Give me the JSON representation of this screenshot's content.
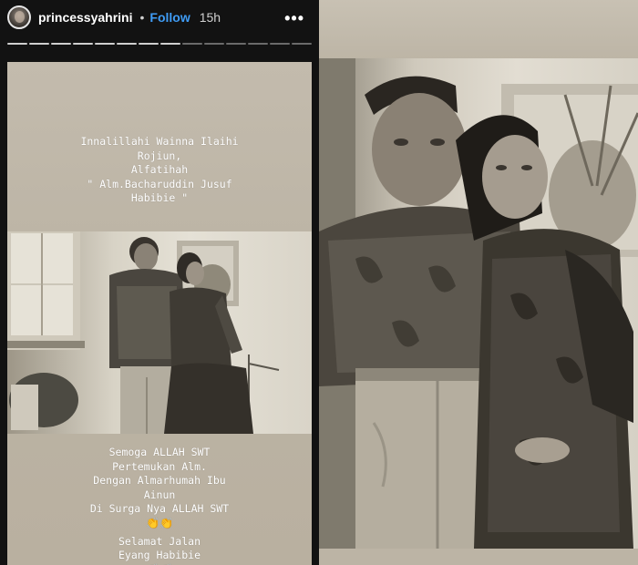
{
  "header": {
    "username": "princessyahrini",
    "separator": "•",
    "follow_label": "Follow",
    "time": "15h",
    "more_icon": "more-options-icon"
  },
  "progress": {
    "segments_total": 14,
    "segments_viewed": 8
  },
  "story": {
    "top_message": [
      "Innalillahi Wainna Ilaihi",
      "Rojiun,",
      "Alfatihah",
      "\" Alm.Bacharuddin Jusuf",
      "Habibie \""
    ],
    "bottom_message": [
      "Semoga ALLAH SWT",
      "Pertemukan Alm.",
      "Dengan Almarhumah Ibu",
      "Ainun",
      "Di Surga Nya ALLAH SWT"
    ],
    "clap_emoji": "👏👏",
    "farewell": [
      "Selamat Jalan",
      "Eyang Habibie"
    ]
  },
  "colors": {
    "follow_blue": "#3f9cf5",
    "card_bg": "#c3bbad",
    "emoji_gold": "#e2b830"
  }
}
